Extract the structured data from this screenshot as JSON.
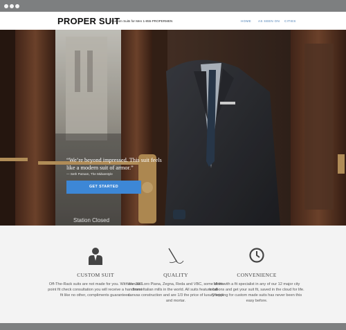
{
  "brand": {
    "logo": "PROPER SUIT",
    "tagline": "Custom Suits for Men 1-855-PROPERMEN"
  },
  "nav": {
    "items": [
      {
        "label": "HOME"
      },
      {
        "label": "AS SEEN ON"
      },
      {
        "label": "CITIES"
      }
    ]
  },
  "hero": {
    "quote": "“We’re beyond impressed. This suit feels like a modern suit of armor.”",
    "attribution": "— Seth Putnam, The Midwestyle",
    "cta_label": "GET STARTED",
    "door_sign": "Station Closed"
  },
  "features": [
    {
      "icon": "suit-person-icon",
      "title": "CUSTOM SUIT",
      "description": "Off-The-Rack suits are not made for you. With our 300 point fit check consultation you will receive a handsome fit like no other, compliments guaranteed."
    },
    {
      "icon": "needle-thread-icon",
      "title": "QUALITY",
      "description": "We  use Loro Piana, Zegna, Reda and VBC, some of the finest Italian mills in the world. All suits feature full-canvas construction and are 1/3 the price of luxury brick and mortar."
    },
    {
      "icon": "clock-icon",
      "title": "CONVENIENCE",
      "description": "Meet with a fit specialist in any of our 12 major city locations and get your suit fit, saved in the cloud for life. Shopping for custom made suits has never been this easy before."
    }
  ],
  "colors": {
    "accent": "#3d87d6",
    "nav_link": "#4a7fb5",
    "chrome": "#7d7f80",
    "background": "#f3f3f3"
  }
}
